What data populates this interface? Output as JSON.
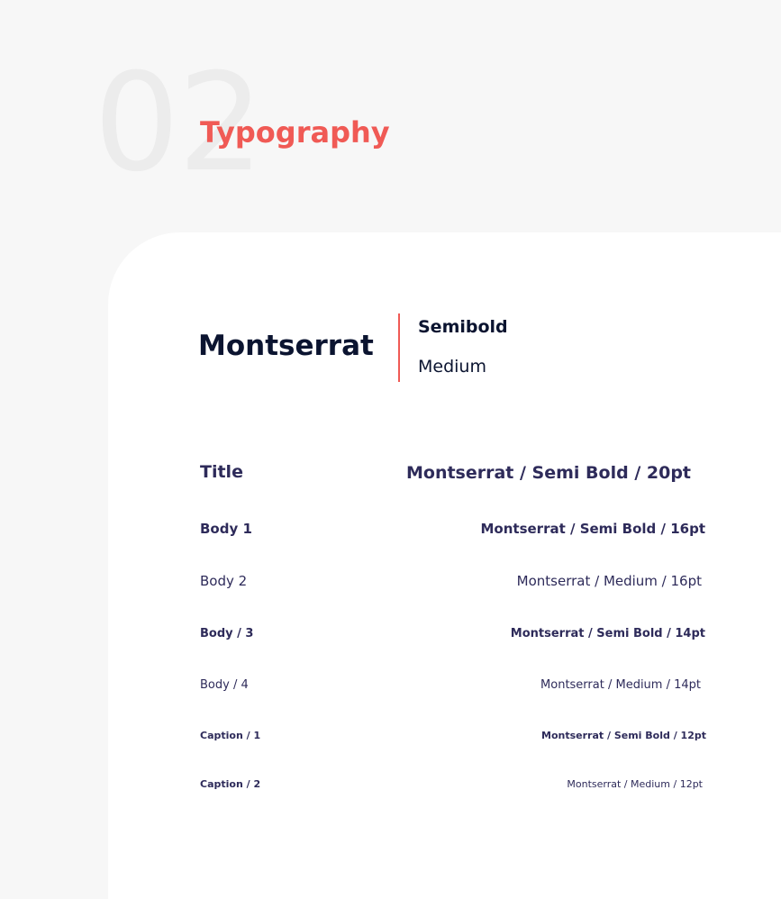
{
  "section": {
    "number": "02",
    "title": "Typography"
  },
  "font": {
    "name": "Montserrat",
    "weights": [
      "Semibold",
      "Medium"
    ]
  },
  "styles": [
    {
      "label": "Title",
      "spec": "Montserrat / Semi Bold / 20pt"
    },
    {
      "label": "Body 1",
      "spec": "Montserrat / Semi Bold / 16pt"
    },
    {
      "label": "Body 2",
      "spec": "Montserrat / Medium / 16pt"
    },
    {
      "label": "Body / 3",
      "spec": "Montserrat / Semi Bold / 14pt"
    },
    {
      "label": "Body / 4",
      "spec": "Montserrat / Medium / 14pt"
    },
    {
      "label": "Caption / 1",
      "spec": "Montserrat / Semi Bold / 12pt"
    },
    {
      "label": "Caption / 2",
      "spec": "Montserrat / Medium / 12pt"
    }
  ],
  "colors": {
    "accent": "#f05a55",
    "text_dark": "#0b1430",
    "text_spec": "#2e2b5a",
    "background": "#f7f7f7",
    "card": "#ffffff"
  }
}
